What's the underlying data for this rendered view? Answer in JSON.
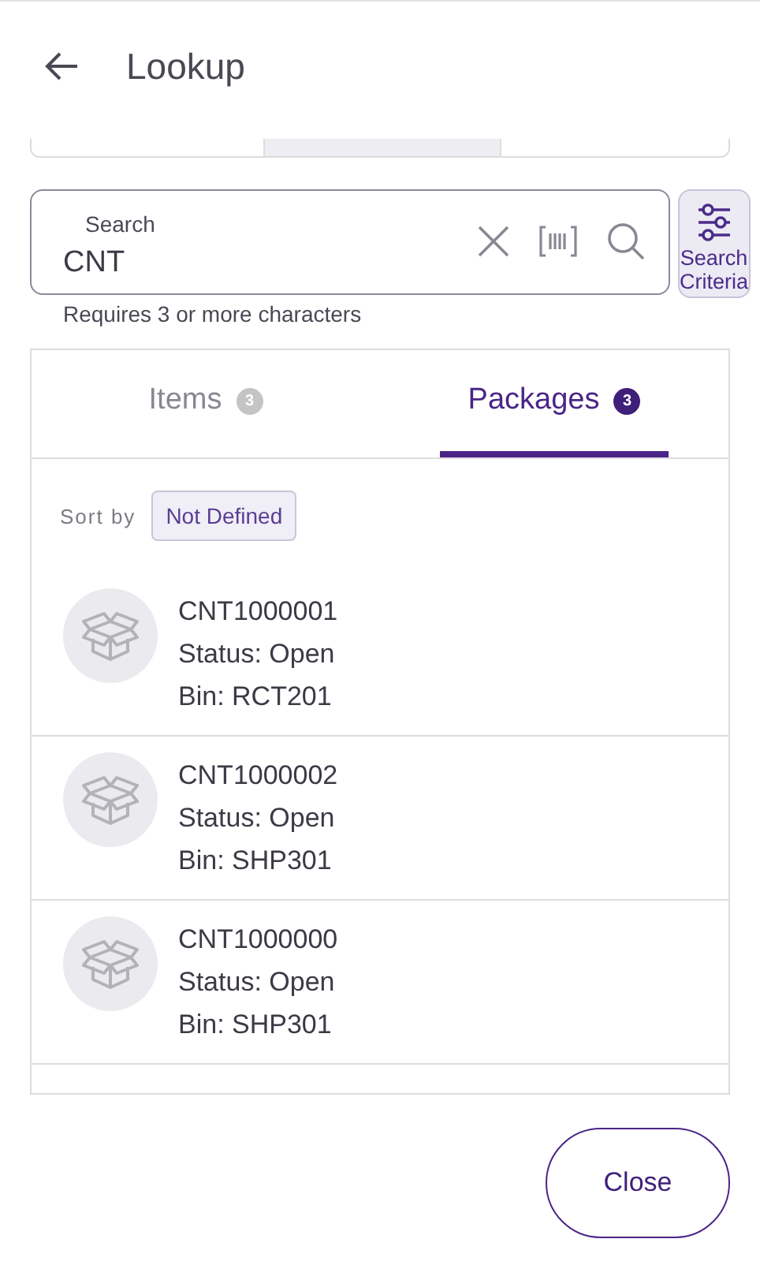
{
  "header": {
    "title": "Lookup"
  },
  "search": {
    "label": "Search",
    "value": "CNT",
    "helper": "Requires 3 or more characters"
  },
  "criteria_button": {
    "label": "Search Criteria"
  },
  "tabs": [
    {
      "label": "Items",
      "count": "3",
      "selected": false
    },
    {
      "label": "Packages",
      "count": "3",
      "selected": true
    }
  ],
  "sort": {
    "label": "Sort by",
    "value": "Not Defined"
  },
  "packages": [
    {
      "id": "CNT1000001",
      "status": "Status: Open",
      "bin": "Bin: RCT201"
    },
    {
      "id": "CNT1000002",
      "status": "Status: Open",
      "bin": "Bin: SHP301"
    },
    {
      "id": "CNT1000000",
      "status": "Status: Open",
      "bin": "Bin: SHP301"
    }
  ],
  "close_button": "Close"
}
